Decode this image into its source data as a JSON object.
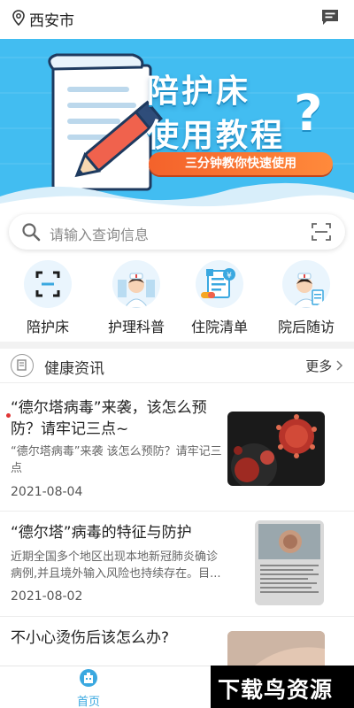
{
  "header": {
    "location": "西安市"
  },
  "banner": {
    "title_line1": "陪护床",
    "title_line2": "使用教程",
    "question_mark": "?",
    "subtitle": "三分钟教你快速使用"
  },
  "search": {
    "placeholder": "请输入查询信息"
  },
  "categories": [
    {
      "label": "陪护床",
      "icon": "scan-bed-icon"
    },
    {
      "label": "护理科普",
      "icon": "nurse-icon"
    },
    {
      "label": "住院清单",
      "icon": "hospital-list-icon"
    },
    {
      "label": "院后随访",
      "icon": "followup-doctor-icon"
    }
  ],
  "news": {
    "title": "健康资讯",
    "more": "更多",
    "articles": [
      {
        "title": "“德尔塔病毒”来袭，该怎么预防？请牢记三点~",
        "desc": "“德尔塔病毒”来袭 该怎么预防？请牢记三点",
        "date": "2021-08-04"
      },
      {
        "title": "“德尔塔”病毒的特征与防护",
        "desc": "近期全国多个地区出现本地新冠肺炎确诊病例,并且境外输入风险也持续存在。目...",
        "date": "2021-08-02"
      },
      {
        "title": "不小心烫伤后该怎么办?",
        "desc": "",
        "date": ""
      }
    ]
  },
  "tabbar": {
    "home_label": "首页"
  },
  "watermark": {
    "text": "下载鸟资源"
  },
  "colors": {
    "accent": "#3aa8e0",
    "banner_bg": "#42bdf1",
    "pill_orange": "#f4622b"
  }
}
